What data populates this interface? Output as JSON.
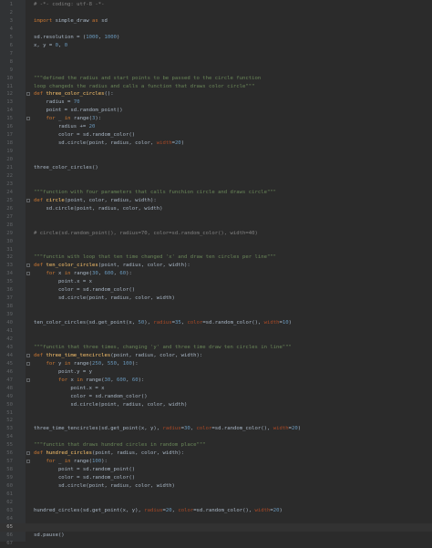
{
  "editor": {
    "lines": [
      {
        "n": "1",
        "tokens": [
          {
            "t": "# -*- coding: utf-8 -*-",
            "c": "cmt"
          }
        ]
      },
      {
        "n": "2",
        "tokens": []
      },
      {
        "n": "3",
        "tokens": [
          {
            "t": "import ",
            "c": "kw"
          },
          {
            "t": "simple_draw ",
            "c": ""
          },
          {
            "t": "as ",
            "c": "kw"
          },
          {
            "t": "sd",
            "c": ""
          }
        ]
      },
      {
        "n": "4",
        "tokens": []
      },
      {
        "n": "5",
        "tokens": [
          {
            "t": "sd.resolution = (",
            "c": ""
          },
          {
            "t": "1000",
            "c": "num"
          },
          {
            "t": ", ",
            "c": ""
          },
          {
            "t": "1000",
            "c": "num"
          },
          {
            "t": ")",
            "c": ""
          }
        ]
      },
      {
        "n": "6",
        "tokens": [
          {
            "t": "x, y = ",
            "c": ""
          },
          {
            "t": "0",
            "c": "num"
          },
          {
            "t": ", ",
            "c": ""
          },
          {
            "t": "0",
            "c": "num"
          }
        ]
      },
      {
        "n": "7",
        "tokens": []
      },
      {
        "n": "8",
        "tokens": []
      },
      {
        "n": "9",
        "tokens": []
      },
      {
        "n": "10",
        "tokens": [
          {
            "t": "\"\"\"defined the radius and start points to be passed to the circle function",
            "c": "str"
          }
        ]
      },
      {
        "n": "11",
        "tokens": [
          {
            "t": "loop changeds the radius and calls a function that draws color circle\"\"\"",
            "c": "str"
          }
        ]
      },
      {
        "n": "12",
        "fold": true,
        "tokens": [
          {
            "t": "def ",
            "c": "kw"
          },
          {
            "t": "three_color_circles",
            "c": "fn"
          },
          {
            "t": "():",
            "c": ""
          }
        ]
      },
      {
        "n": "13",
        "tokens": [
          {
            "t": "    radius = ",
            "c": ""
          },
          {
            "t": "70",
            "c": "num"
          }
        ]
      },
      {
        "n": "14",
        "tokens": [
          {
            "t": "    point = sd.random_point()",
            "c": ""
          }
        ]
      },
      {
        "n": "15",
        "fold": true,
        "tokens": [
          {
            "t": "    ",
            "c": ""
          },
          {
            "t": "for ",
            "c": "kw"
          },
          {
            "t": "_ ",
            "c": ""
          },
          {
            "t": "in ",
            "c": "kw"
          },
          {
            "t": "range(",
            "c": ""
          },
          {
            "t": "3",
            "c": "num"
          },
          {
            "t": "):",
            "c": ""
          }
        ]
      },
      {
        "n": "16",
        "tokens": [
          {
            "t": "        radius += ",
            "c": ""
          },
          {
            "t": "20",
            "c": "num"
          }
        ]
      },
      {
        "n": "17",
        "tokens": [
          {
            "t": "        color = sd.random_color()",
            "c": ""
          }
        ]
      },
      {
        "n": "18",
        "tokens": [
          {
            "t": "        sd.circle(point, radius, color, ",
            "c": ""
          },
          {
            "t": "width",
            "c": "param"
          },
          {
            "t": "=",
            "c": ""
          },
          {
            "t": "20",
            "c": "num"
          },
          {
            "t": ")",
            "c": ""
          }
        ]
      },
      {
        "n": "19",
        "tokens": []
      },
      {
        "n": "20",
        "tokens": []
      },
      {
        "n": "21",
        "tokens": [
          {
            "t": "three_color_circles()",
            "c": ""
          }
        ]
      },
      {
        "n": "22",
        "tokens": []
      },
      {
        "n": "23",
        "tokens": []
      },
      {
        "n": "24",
        "tokens": [
          {
            "t": "\"\"\"function with four parameters that calls funchion circle and draws circle\"\"\"",
            "c": "str"
          }
        ]
      },
      {
        "n": "25",
        "fold": true,
        "tokens": [
          {
            "t": "def ",
            "c": "kw"
          },
          {
            "t": "circle",
            "c": "fn"
          },
          {
            "t": "(point, color, radius, width):",
            "c": ""
          }
        ]
      },
      {
        "n": "26",
        "tokens": [
          {
            "t": "    sd.circle(point, radius, color, width)",
            "c": ""
          }
        ]
      },
      {
        "n": "27",
        "tokens": []
      },
      {
        "n": "28",
        "tokens": []
      },
      {
        "n": "29",
        "tokens": [
          {
            "t": "# circle(sd.random_point(), radius=70, color=sd.random_color(), width=40)",
            "c": "cmt"
          }
        ]
      },
      {
        "n": "30",
        "tokens": []
      },
      {
        "n": "31",
        "tokens": []
      },
      {
        "n": "32",
        "tokens": [
          {
            "t": "\"\"\"functin with loop that ten time changed 'x' and draw ten circles per line\"\"\"",
            "c": "str"
          }
        ]
      },
      {
        "n": "33",
        "fold": true,
        "tokens": [
          {
            "t": "def ",
            "c": "kw"
          },
          {
            "t": "ten_color_circles",
            "c": "fn"
          },
          {
            "t": "(point, radius, color, width):",
            "c": ""
          }
        ]
      },
      {
        "n": "34",
        "fold": true,
        "tokens": [
          {
            "t": "    ",
            "c": ""
          },
          {
            "t": "for ",
            "c": "kw"
          },
          {
            "t": "x ",
            "c": ""
          },
          {
            "t": "in ",
            "c": "kw"
          },
          {
            "t": "range(",
            "c": ""
          },
          {
            "t": "30",
            "c": "num"
          },
          {
            "t": ", ",
            "c": ""
          },
          {
            "t": "600",
            "c": "num"
          },
          {
            "t": ", ",
            "c": ""
          },
          {
            "t": "60",
            "c": "num"
          },
          {
            "t": "):",
            "c": ""
          }
        ]
      },
      {
        "n": "35",
        "tokens": [
          {
            "t": "        point.x = x",
            "c": ""
          }
        ]
      },
      {
        "n": "36",
        "tokens": [
          {
            "t": "        color = sd.random_color()",
            "c": ""
          }
        ]
      },
      {
        "n": "37",
        "tokens": [
          {
            "t": "        sd.circle(point, radius, color, width)",
            "c": ""
          }
        ]
      },
      {
        "n": "38",
        "tokens": []
      },
      {
        "n": "39",
        "tokens": []
      },
      {
        "n": "40",
        "tokens": [
          {
            "t": "ten_color_circles(sd.get_point(x, ",
            "c": ""
          },
          {
            "t": "50",
            "c": "num"
          },
          {
            "t": "), ",
            "c": ""
          },
          {
            "t": "radius",
            "c": "param"
          },
          {
            "t": "=",
            "c": ""
          },
          {
            "t": "35",
            "c": "num"
          },
          {
            "t": ", ",
            "c": ""
          },
          {
            "t": "color",
            "c": "param"
          },
          {
            "t": "=sd.random_color(), ",
            "c": ""
          },
          {
            "t": "width",
            "c": "param"
          },
          {
            "t": "=",
            "c": ""
          },
          {
            "t": "10",
            "c": "num"
          },
          {
            "t": ")",
            "c": ""
          }
        ]
      },
      {
        "n": "41",
        "tokens": []
      },
      {
        "n": "42",
        "tokens": []
      },
      {
        "n": "43",
        "tokens": [
          {
            "t": "\"\"\"functin that three times, changing 'y' and three time draw ten circles in line\"\"\"",
            "c": "str"
          }
        ]
      },
      {
        "n": "44",
        "fold": true,
        "tokens": [
          {
            "t": "def ",
            "c": "kw"
          },
          {
            "t": "three_time_tencircles",
            "c": "fn"
          },
          {
            "t": "(point, radius, color, width):",
            "c": ""
          }
        ]
      },
      {
        "n": "45",
        "fold": true,
        "tokens": [
          {
            "t": "    ",
            "c": ""
          },
          {
            "t": "for ",
            "c": "kw"
          },
          {
            "t": "y ",
            "c": ""
          },
          {
            "t": "in ",
            "c": "kw"
          },
          {
            "t": "range(",
            "c": ""
          },
          {
            "t": "250",
            "c": "num"
          },
          {
            "t": ", ",
            "c": ""
          },
          {
            "t": "550",
            "c": "num"
          },
          {
            "t": ", ",
            "c": ""
          },
          {
            "t": "100",
            "c": "num"
          },
          {
            "t": "):",
            "c": ""
          }
        ]
      },
      {
        "n": "46",
        "tokens": [
          {
            "t": "        point.y = y",
            "c": ""
          }
        ]
      },
      {
        "n": "47",
        "fold": true,
        "tokens": [
          {
            "t": "        ",
            "c": ""
          },
          {
            "t": "for ",
            "c": "kw"
          },
          {
            "t": "x ",
            "c": ""
          },
          {
            "t": "in ",
            "c": "kw"
          },
          {
            "t": "range(",
            "c": ""
          },
          {
            "t": "30",
            "c": "num"
          },
          {
            "t": ", ",
            "c": ""
          },
          {
            "t": "600",
            "c": "num"
          },
          {
            "t": ", ",
            "c": ""
          },
          {
            "t": "60",
            "c": "num"
          },
          {
            "t": "):",
            "c": ""
          }
        ]
      },
      {
        "n": "48",
        "tokens": [
          {
            "t": "            point.x = x",
            "c": ""
          }
        ]
      },
      {
        "n": "49",
        "tokens": [
          {
            "t": "            color = sd.random_color()",
            "c": ""
          }
        ]
      },
      {
        "n": "50",
        "tokens": [
          {
            "t": "            sd.circle(point, radius, color, width)",
            "c": ""
          }
        ]
      },
      {
        "n": "51",
        "tokens": []
      },
      {
        "n": "52",
        "tokens": []
      },
      {
        "n": "53",
        "tokens": [
          {
            "t": "three_time_tencircles(sd.get_point(x, y), ",
            "c": ""
          },
          {
            "t": "radius",
            "c": "param"
          },
          {
            "t": "=",
            "c": ""
          },
          {
            "t": "30",
            "c": "num"
          },
          {
            "t": ", ",
            "c": ""
          },
          {
            "t": "color",
            "c": "param"
          },
          {
            "t": "=sd.random_color(), ",
            "c": ""
          },
          {
            "t": "width",
            "c": "param"
          },
          {
            "t": "=",
            "c": ""
          },
          {
            "t": "20",
            "c": "num"
          },
          {
            "t": ")",
            "c": ""
          }
        ]
      },
      {
        "n": "54",
        "tokens": []
      },
      {
        "n": "55",
        "tokens": [
          {
            "t": "\"\"\"functin that draws hundred circles in random place\"\"\"",
            "c": "str"
          }
        ]
      },
      {
        "n": "56",
        "fold": true,
        "tokens": [
          {
            "t": "def ",
            "c": "kw"
          },
          {
            "t": "hundred_circles",
            "c": "fn"
          },
          {
            "t": "(point, radius, color, width):",
            "c": ""
          }
        ]
      },
      {
        "n": "57",
        "fold": true,
        "tokens": [
          {
            "t": "    ",
            "c": ""
          },
          {
            "t": "for ",
            "c": "kw"
          },
          {
            "t": "_ ",
            "c": ""
          },
          {
            "t": "in ",
            "c": "kw"
          },
          {
            "t": "range(",
            "c": ""
          },
          {
            "t": "100",
            "c": "num"
          },
          {
            "t": "):",
            "c": ""
          }
        ]
      },
      {
        "n": "58",
        "tokens": [
          {
            "t": "        point = sd.random_point()",
            "c": ""
          }
        ]
      },
      {
        "n": "59",
        "tokens": [
          {
            "t": "        color = sd.random_color()",
            "c": ""
          }
        ]
      },
      {
        "n": "60",
        "tokens": [
          {
            "t": "        sd.circle(point, radius, color, width)",
            "c": ""
          }
        ]
      },
      {
        "n": "61",
        "tokens": []
      },
      {
        "n": "62",
        "tokens": []
      },
      {
        "n": "63",
        "tokens": [
          {
            "t": "hundred_circles(sd.get_point(x, y), ",
            "c": ""
          },
          {
            "t": "radius",
            "c": "param"
          },
          {
            "t": "=",
            "c": ""
          },
          {
            "t": "20",
            "c": "num"
          },
          {
            "t": ", ",
            "c": ""
          },
          {
            "t": "color",
            "c": "param"
          },
          {
            "t": "=sd.random_color(), ",
            "c": ""
          },
          {
            "t": "width",
            "c": "param"
          },
          {
            "t": "=",
            "c": ""
          },
          {
            "t": "20",
            "c": "num"
          },
          {
            "t": ")",
            "c": ""
          }
        ]
      },
      {
        "n": "64",
        "tokens": []
      },
      {
        "n": "65",
        "current": true,
        "tokens": []
      },
      {
        "n": "66",
        "tokens": [
          {
            "t": "sd.pause()",
            "c": ""
          }
        ]
      },
      {
        "n": "67",
        "tokens": []
      }
    ]
  },
  "colors": {
    "background": "#2b2b2b",
    "keyword": "#cc7832",
    "function": "#ffc66d",
    "number": "#6897bb",
    "string": "#6a8759",
    "comment": "#808080",
    "param": "#aa4926",
    "text": "#a9b7c6"
  }
}
